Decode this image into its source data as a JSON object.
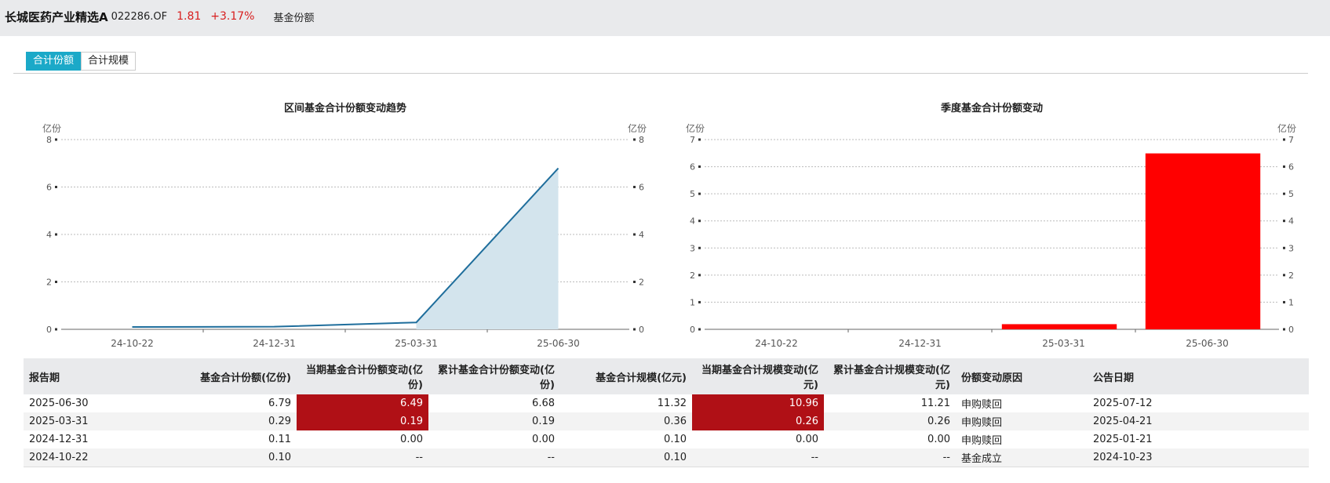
{
  "header": {
    "fund_name": "长城医药产业精选A",
    "fund_code": "022286.OF",
    "price": "1.81",
    "change_pct": "+3.17%",
    "section": "基金份额"
  },
  "tabs": [
    {
      "label": "合计份额",
      "active": true
    },
    {
      "label": "合计规模",
      "active": false
    }
  ],
  "colors": {
    "accent": "#1ba9c8",
    "up": "#d81e1e",
    "line": "#1f6e9c",
    "area": "#d3e4ed",
    "bar": "#ff0000",
    "highlight": "#b01016"
  },
  "chart_data": [
    {
      "type": "area",
      "title": "区间基金合计份额变动趋势",
      "ylabel_left": "亿份",
      "ylabel_right": "亿份",
      "categories": [
        "24-10-22",
        "24-12-31",
        "25-03-31",
        "25-06-30"
      ],
      "values": [
        0.1,
        0.11,
        0.29,
        6.79
      ],
      "ylim": [
        0,
        8
      ],
      "yticks": [
        "0",
        "2",
        "4",
        "6",
        "8"
      ],
      "grid": true
    },
    {
      "type": "bar",
      "title": "季度基金合计份额变动",
      "ylabel_left": "亿份",
      "ylabel_right": "亿份",
      "categories": [
        "24-10-22",
        "24-12-31",
        "25-03-31",
        "25-06-30"
      ],
      "values": [
        0,
        0,
        0.19,
        6.49
      ],
      "ylim": [
        0,
        7
      ],
      "yticks": [
        "0",
        "1",
        "2",
        "3",
        "4",
        "5",
        "6",
        "7"
      ],
      "grid": true
    }
  ],
  "table": {
    "headers": [
      "报告期",
      "基金合计份额(亿份)",
      "当期基金合计份额变动(亿份)",
      "累计基金合计份额变动(亿份)",
      "基金合计规模(亿元)",
      "当期基金合计规模变动(亿元)",
      "累计基金合计规模变动(亿元)",
      "份额变动原因",
      "公告日期"
    ],
    "rows": [
      [
        "2025-06-30",
        "6.79",
        "6.49",
        "6.68",
        "11.32",
        "10.96",
        "11.21",
        "申购赎回",
        "2025-07-12"
      ],
      [
        "2025-03-31",
        "0.29",
        "0.19",
        "0.19",
        "0.36",
        "0.26",
        "0.26",
        "申购赎回",
        "2025-04-21"
      ],
      [
        "2024-12-31",
        "0.11",
        "0.00",
        "0.00",
        "0.10",
        "0.00",
        "0.00",
        "申购赎回",
        "2025-01-21"
      ],
      [
        "2024-10-22",
        "0.10",
        "--",
        "--",
        "0.10",
        "--",
        "--",
        "基金成立",
        "2024-10-23"
      ]
    ]
  }
}
